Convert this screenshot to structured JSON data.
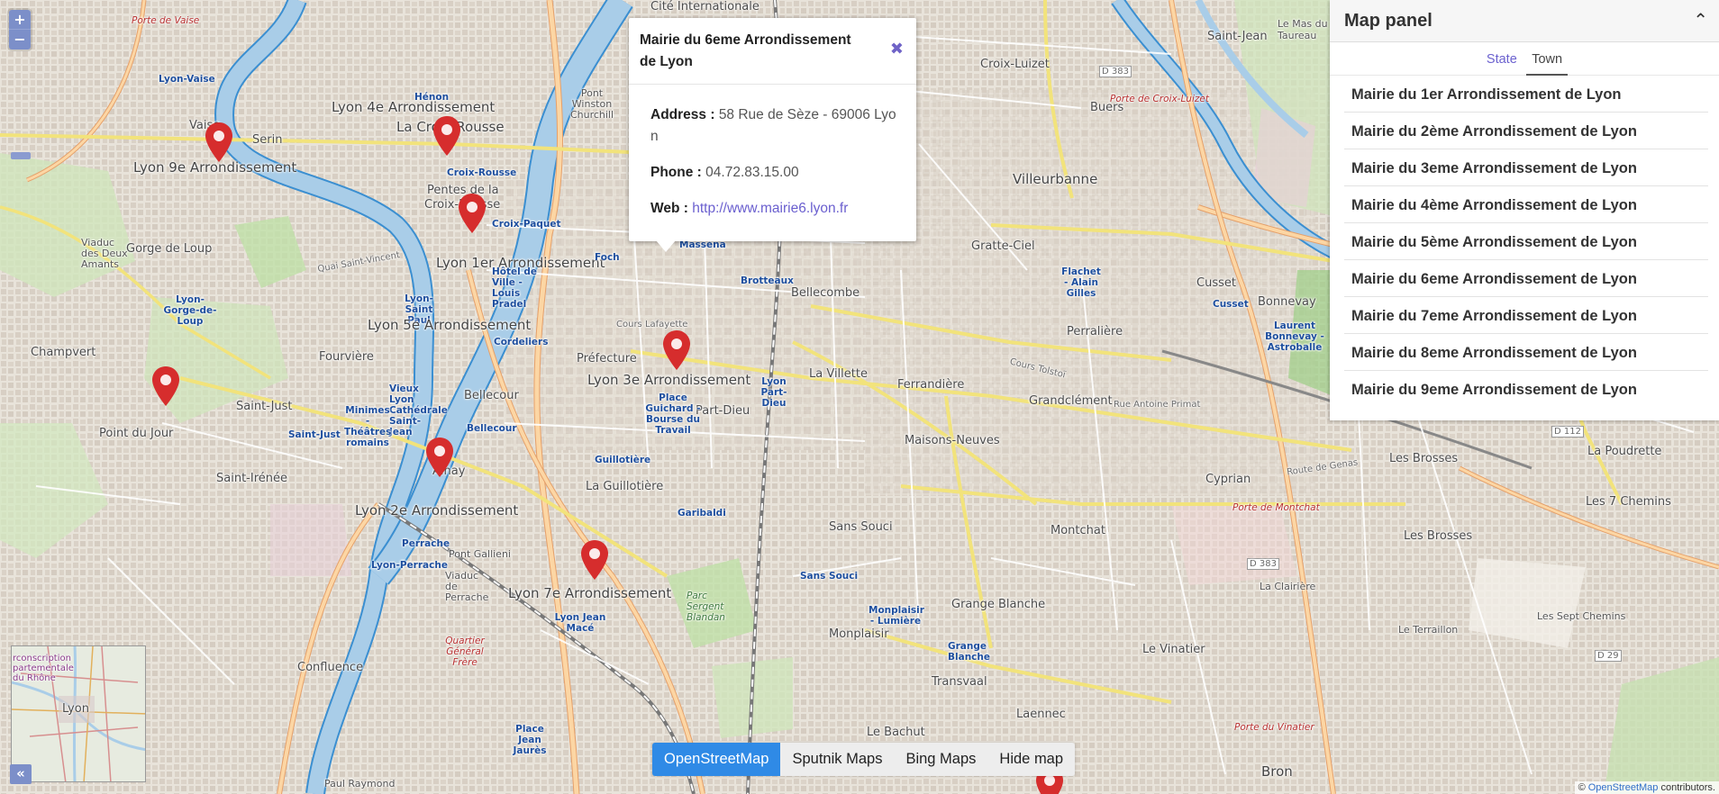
{
  "map": {
    "labels": {
      "porte_de_vaise": "Porte de Vaise",
      "lyon_vaise": "Lyon-Vaise",
      "vaise": "Vaise",
      "serin": "Serin",
      "lyon_9e": "Lyon 9e Arrondissement",
      "lyon_4e": "Lyon 4e Arrondissement",
      "henon": "Hénon",
      "la_croix_rousse": "La Croix-Rousse",
      "croix_rousse_stop": "Croix-Rousse",
      "pentes": "Pentes de la",
      "croix_rousse2": "Croix-Rousse",
      "croix_paquet": "Croix-Paquet",
      "gorge_de_loup": "Gorge de Loup",
      "lyon_1er": "Lyon 1er Arrondissement",
      "hotel_de_ville": "Hôtel de Ville - Louis Pradel",
      "foch": "Foch",
      "massena": "Masséna",
      "brotteaux": "Brotteaux",
      "bellecombe": "Bellecombe",
      "villeurbanne": "Villeurbanne",
      "gratte_ciel": "Gratte-Ciel",
      "croix_luizet": "Croix-Luizet",
      "buers": "Buers",
      "saint_jean": "Saint-Jean",
      "le_mas": "Le Mas du Taureau",
      "cusset": "Cusset",
      "cusset_stop": "Cusset",
      "flachet": "Flachet - Alain Gilles",
      "bonnevay": "Bonnevay",
      "laurent_bonnevay": "Laurent Bonnevay - Astroballe",
      "perralliere": "Perralière",
      "champvert": "Champvert",
      "lyon_gorge_de_loup": "Lyon-Gorge-de-Loup",
      "lyon_saint_paul": "Lyon-Saint Paul",
      "fourviere": "Fourvière",
      "lyon_5e": "Lyon 5e Arrondissement",
      "cordeliers": "Cordeliers",
      "prefecture": "Préfecture",
      "lyon_3e": "Lyon 3e Arrondissement",
      "lyon_part_dieu": "Lyon Part-Dieu",
      "part_dieu": "Part-Dieu",
      "la_villette": "La Villette",
      "ferrandiere": "Ferrandière",
      "grandclement": "Grandclément",
      "place_guichard": "Place Guichard - Bourse du Travail",
      "saint_just": "Saint-Just",
      "saint_just_stop": "Saint-Just",
      "vieux_lyon": "Vieux Lyon Cathédrale Saint-Jean",
      "minimes": "Minimes - Théâtres romains",
      "bellecour": "Bellecour",
      "bellecour_stop": "Bellecour",
      "point_du_jour": "Point du Jour",
      "ainay": "Ainay",
      "guillotiere_stop": "Guillotière",
      "la_guillotiere": "La Guillotière",
      "maisons_neuves": "Maisons-Neuves",
      "cyprian": "Cyprian",
      "les_brosses": "Les Brosses",
      "la_poudrette": "La Poudrette",
      "les_7_chemins": "Les 7 Chemins",
      "saint_irenee": "Saint-Irénée",
      "lyon_2e": "Lyon 2e Arrondissement",
      "garibaldi": "Garibaldi",
      "sans_souci": "Sans Souci",
      "sans_souci_stop": "Sans Souci",
      "montchat": "Montchat",
      "les_brosses2": "Les Brosses",
      "perrache": "Perrache",
      "pont_gallieni": "Pont Gallieni",
      "lyon_perrache": "Lyon-Perrache",
      "lyon_7e": "Lyon 7e Arrondissement",
      "parc_sergent": "Parc Sergent Blandan",
      "monplaisir_lumiere": "Monplaisir - Lumière",
      "grange_blanche": "Grange Blanche",
      "monplaisir": "Monplaisir",
      "confluence": "Confluence",
      "quartier_gerland": "Quartier Général Frère",
      "lyon_jean_mace": "Lyon Jean Macé",
      "transvaal": "Transvaal",
      "le_vinatier": "Le Vinatier",
      "grange_blanche_stop": "Grange Blanche",
      "laennec": "Laennec",
      "le_bachut": "Le Bachut",
      "place_jean_jaures": "Place Jean Jaurès",
      "paul_raymond": "Paul Raymond",
      "bron": "Bron",
      "d383a": "D 383",
      "d383b": "D 383",
      "d112": "D 112",
      "d29": "D 29",
      "cours_tolstoi": "Cours Tolstoï",
      "route_de_genas": "Route de Genas",
      "rue_antoine_primat": "Rue Antoine Primat",
      "cours_lafayette": "Cours Lafayette",
      "quai_saint_vincent": "Quai Saint-Vincent",
      "pont_winston": "Pont Winston Churchill",
      "porte_croix_luizet": "Porte de Croix-Luizet",
      "porte_montchat": "Porte de Montchat",
      "porte_vinatier": "Porte du Vinatier",
      "viaduc_perrache": "Viaduc de Perrache",
      "la_clairiere": "La Clairière",
      "le_terraillon": "Le Terraillon",
      "les_sept_chemins": "Les Sept Chemins",
      "viaduc_des_deux_amants": "Viaduc des Deux Amants",
      "cite_internationale": "Cité Internationale"
    },
    "marker_color": "#d62d2d",
    "minimap": {
      "label_circ": "rconscription partementale du Rhône",
      "label_lyon": "Lyon"
    }
  },
  "zoom": {
    "in": "+",
    "out": "−"
  },
  "popup": {
    "title": "Mairie du 6eme Arrondissement de Lyon",
    "close_icon": "✖",
    "address_label": "Address :",
    "address_value": "58 Rue de Sèze - 69006 Lyo n",
    "phone_label": "Phone :",
    "phone_value": "04.72.83.15.00",
    "web_label": "Web :",
    "web_value": "http://www.mairie6.lyon.fr"
  },
  "panel": {
    "title": "Map panel",
    "collapse_icon": "⌃",
    "tabs": {
      "state": "State",
      "town": "Town"
    },
    "items": [
      "Mairie du 1er Arrondissement de Lyon",
      "Mairie du 2ème Arrondissement de Lyon",
      "Mairie du 3eme Arrondissement de Lyon",
      "Mairie du 4ème Arrondissement de Lyon",
      "Mairie du 5ème Arrondissement de Lyon",
      "Mairie du 6eme Arrondissement de Lyon",
      "Mairie du 7eme Arrondissement de Lyon",
      "Mairie du 8eme Arrondissement de Lyon",
      "Mairie du 9eme Arrondissement de Lyon"
    ]
  },
  "layers": {
    "openstreetmap": "OpenStreetMap",
    "sputnik": "Sputnik Maps",
    "bing": "Bing Maps",
    "hide": "Hide map"
  },
  "minimap_toggle": "«",
  "attribution": {
    "prefix": "© ",
    "link": "OpenStreetMap",
    "suffix": " contributors."
  },
  "colors": {
    "accent": "#6c62cf",
    "layer_active": "#2f8ae6",
    "zoom": "#7c8fc9",
    "river": "#a9cde8",
    "river_edge": "#3b8fd1"
  }
}
